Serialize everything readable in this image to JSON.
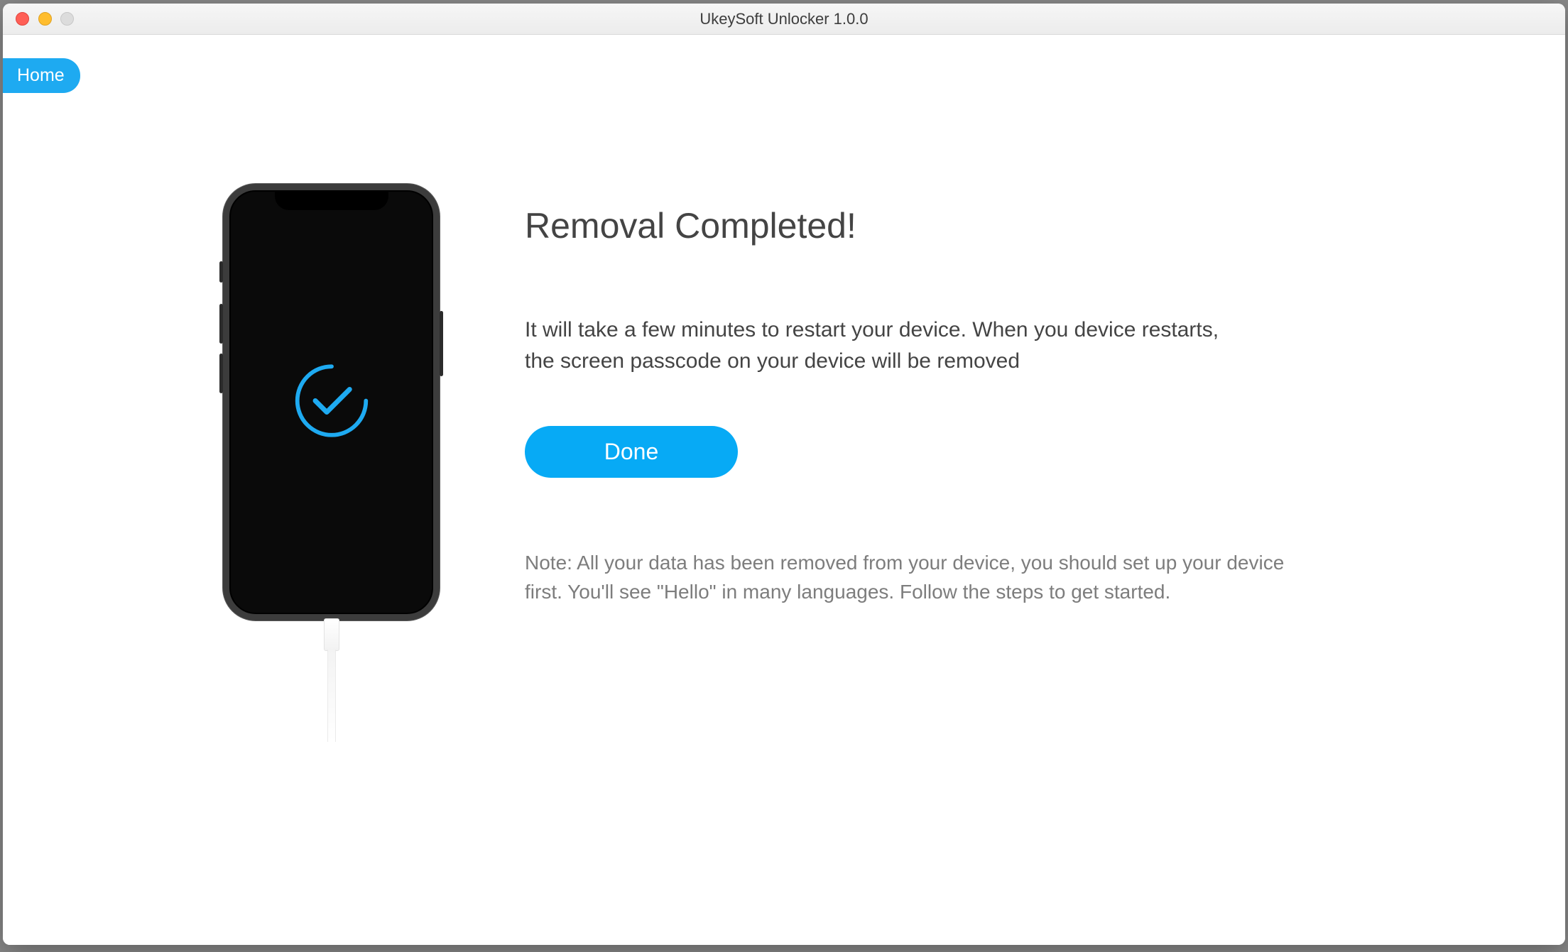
{
  "window": {
    "title": "UkeySoft Unlocker 1.0.0"
  },
  "nav": {
    "home_label": "Home"
  },
  "main": {
    "heading": "Removal Completed!",
    "body": "It will take a few minutes to restart your device. When you device restarts, the screen passcode on your device will be removed",
    "done_label": "Done",
    "note": "Note: All your data has been removed from your device, you should set up your device first. You'll see \"Hello\" in many languages. Follow the steps to get started."
  },
  "colors": {
    "accent": "#07aaf5"
  }
}
